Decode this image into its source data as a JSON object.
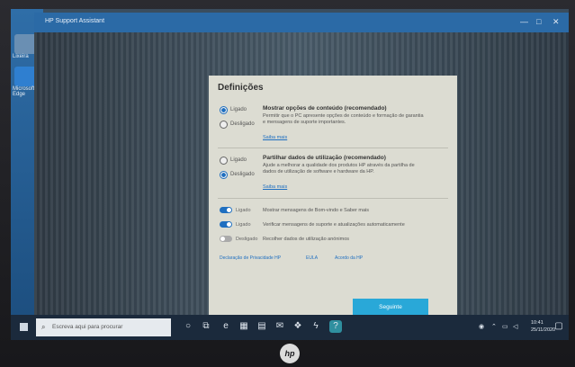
{
  "app": {
    "title": "HP Support Assistant",
    "window_controls": [
      "—",
      "□",
      "✕"
    ]
  },
  "desktop": {
    "icons": [
      "Lixeira",
      "Microsoft Edge"
    ]
  },
  "dialog": {
    "title": "Definições",
    "section1": {
      "title": "Mostrar opções de conteúdo (recomendado)",
      "text": "Permitir que o PC apresente opções de conteúdo e formação de garantia e mensagens de suporte importantes.",
      "link": "Saiba mais"
    },
    "section2": {
      "title": "Partilhar dados de utilização (recomendado)",
      "text": "Ajude a melhorar a qualidade dos produtos HP através da partilha de dados de utilização de software e hardware da HP.",
      "link": "Saiba mais"
    },
    "radio_labels": {
      "on": "Ligado",
      "off": "Desligado"
    },
    "toggles": [
      {
        "label": "Ligado",
        "text": "Mostrar mensagens de Bom-vindo e Saber mais",
        "state": "on"
      },
      {
        "label": "Ligado",
        "text": "Verificar mensagens de suporte e atualizações automaticamente",
        "state": "on"
      },
      {
        "label": "Desligado",
        "text": "Recolher dados de utilização anónimos",
        "state": "off"
      }
    ],
    "footer_links": [
      "Declaração de Privacidade HP",
      "EULA",
      "Acordo da HP"
    ],
    "primary_button": "Seguinte"
  },
  "taskbar": {
    "search_placeholder": "Escreva aqui para procurar",
    "time": "10:41",
    "date": "25/11/2020"
  },
  "colors": {
    "accent": "#1f6fc0",
    "button": "#29a8d8",
    "taskbar": "#1b2a3c"
  }
}
